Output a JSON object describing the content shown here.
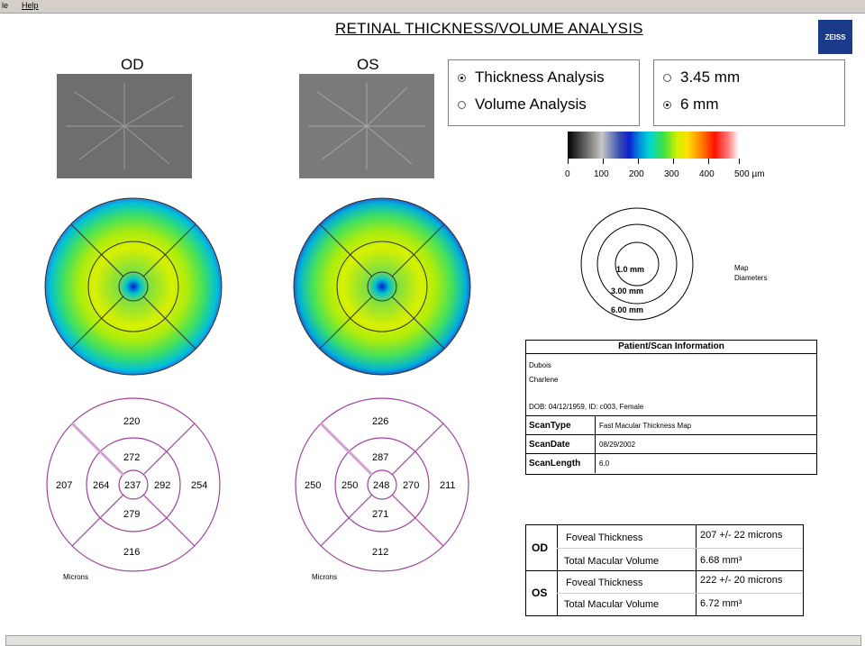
{
  "menu": {
    "item1": "le",
    "item2": "Help"
  },
  "title": "RETINAL THICKNESS/VOLUME ANALYSIS",
  "logo_text": "ZEISS",
  "eyes": {
    "od_label": "OD",
    "os_label": "OS"
  },
  "analysis_options": [
    {
      "label": "Thickness Analysis",
      "selected": true
    },
    {
      "label": "Volume Analysis",
      "selected": false
    }
  ],
  "diameter_options": [
    {
      "label": "3.45 mm",
      "selected": false
    },
    {
      "label": "6 mm",
      "selected": true
    }
  ],
  "color_scale": {
    "ticks": [
      "0",
      "100",
      "200",
      "300",
      "400",
      "500 µm"
    ]
  },
  "map_diameters": {
    "labels": [
      "1.0 mm",
      "3.00 mm",
      "6.00 mm"
    ],
    "caption_1": "Map",
    "caption_2": "Diameters"
  },
  "od_values": {
    "outer_sup": "220",
    "outer_temp": "207",
    "outer_nasal": "254",
    "outer_inf": "216",
    "inner_sup": "272",
    "inner_temp": "264",
    "inner_nasal": "292",
    "inner_inf": "279",
    "center": "237",
    "units": "Microns"
  },
  "os_values": {
    "outer_sup": "226",
    "outer_temp": "250",
    "outer_nasal": "211",
    "outer_inf": "212",
    "inner_sup": "287",
    "inner_temp": "250",
    "inner_nasal": "270",
    "inner_inf": "271",
    "center": "248",
    "units": "Microns"
  },
  "patient": {
    "header": "Patient/Scan Information",
    "last_name": "Dubois",
    "first_name": "Charlene",
    "details": "DOB: 04/12/1959, ID: c003, Female",
    "rows": [
      {
        "key": "ScanType",
        "value": "Fast Macular Thickness Map"
      },
      {
        "key": "ScanDate",
        "value": "08/29/2002"
      },
      {
        "key": "ScanLength",
        "value": "6.0"
      }
    ]
  },
  "measurements": {
    "od_label": "OD",
    "os_label": "OS",
    "od_foveal_label": "Foveal Thickness",
    "od_foveal_value": "207 +/- 22 microns",
    "od_volume_label": "Total Macular Volume",
    "od_volume_value": "6.68 mm³",
    "os_foveal_label": "Foveal Thickness",
    "os_foveal_value": "222 +/- 20 microns",
    "os_volume_label": "Total Macular Volume",
    "os_volume_value": "6.72 mm³"
  },
  "colors": {
    "ring": "#a040a0",
    "panel_border": "#808080"
  }
}
